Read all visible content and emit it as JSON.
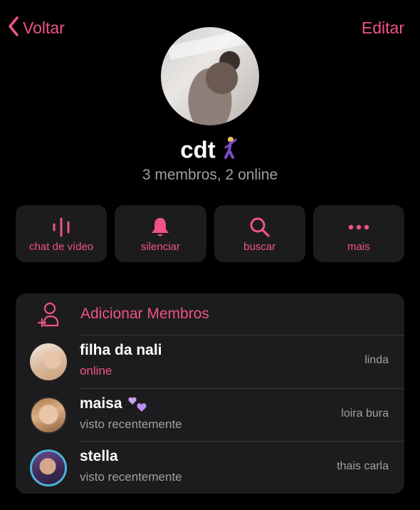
{
  "header": {
    "back_label": "Voltar",
    "edit_label": "Editar"
  },
  "group": {
    "name": "cdt",
    "name_emoji": "dancing-man",
    "meta": "3 membros, 2 online"
  },
  "actions": [
    {
      "label": "chat de vídeo",
      "icon": "voice-wave-icon"
    },
    {
      "label": "silenciar",
      "icon": "bell-icon"
    },
    {
      "label": "buscar",
      "icon": "search-icon"
    },
    {
      "label": "mais",
      "icon": "more-icon"
    }
  ],
  "members_section": {
    "add_label": "Adicionar Membros",
    "members": [
      {
        "name": "filha da nali",
        "status": "online",
        "status_color": "#f0528a",
        "title": "linda"
      },
      {
        "name": "maisa",
        "name_emoji": "purple-hearts",
        "status": "visto recentemente",
        "status_color": "#a0a0a4",
        "title": "loira bura"
      },
      {
        "name": "stella",
        "status": "visto recentemente",
        "status_color": "#a0a0a4",
        "title": "thais carla"
      }
    ]
  },
  "colors": {
    "accent": "#f0528a",
    "background": "#000000",
    "card": "#1c1c1e",
    "secondary_text": "#a0a0a4"
  }
}
